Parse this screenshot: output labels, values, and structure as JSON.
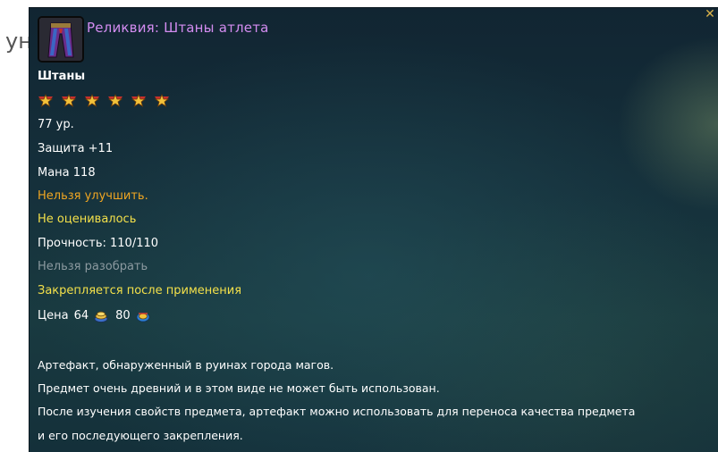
{
  "background_text": "ун",
  "tooltip": {
    "title": "Реликвия: Штаны атлета",
    "type": "Штаны",
    "stars_count": 6,
    "level": "77 ур.",
    "defense": "Защита +11",
    "mana": "Мана 118",
    "no_upgrade": "Нельзя улучшить.",
    "not_evaluated": "Не оценивалось",
    "durability": "Прочность: 110/110",
    "no_disassemble": "Нельзя разобрать",
    "binding": "Закрепляется после применения",
    "price": {
      "label": "Цена",
      "value1": "64",
      "value2": "80"
    },
    "description": [
      "Артефакт, обнаруженный в руинах города магов.",
      "Предмет очень древний и в этом виде не может быть использован.",
      "После изучения свойств предмета, артефакт можно использовать для переноса качества предмета",
      "и его последующего закрепления."
    ],
    "close_icon": "close-x-icon",
    "colors": {
      "title": "#d38cf0",
      "warning": "#f0a622",
      "highlight": "#f3e04a",
      "disabled": "#8c9aa0",
      "text": "#ffffff"
    }
  }
}
